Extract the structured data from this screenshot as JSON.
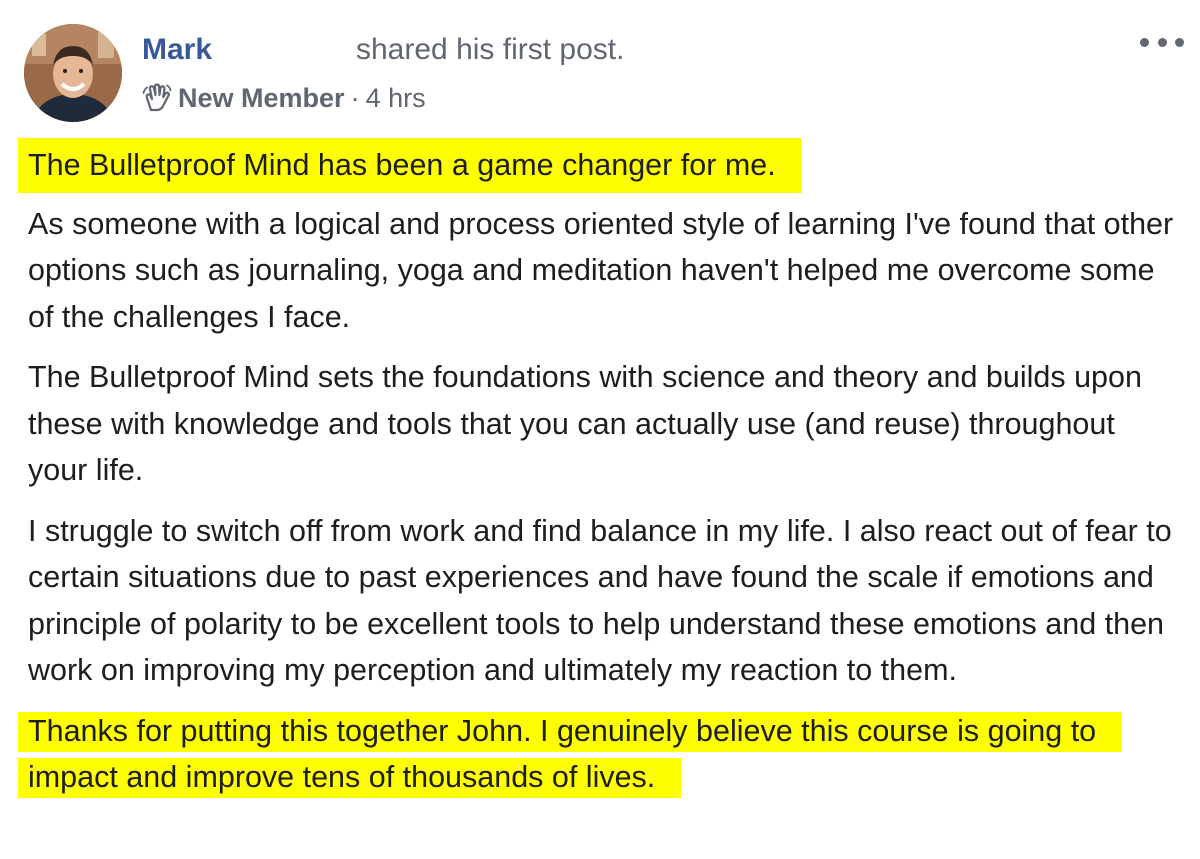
{
  "post": {
    "author": "Mark",
    "action": "shared his first post.",
    "badge": "New Member",
    "separator": "·",
    "time": "4 hrs",
    "icons": {
      "more": "more-horizontal-icon",
      "badge": "waving-hand-icon",
      "avatar": "profile-photo"
    },
    "highlight_color": "#ffff00",
    "name_color": "#385898",
    "paragraphs": [
      "The Bulletproof Mind has been a game changer for me.",
      "As someone with a logical and process oriented style of learning I've found that other options such as journaling, yoga and meditation haven't helped me overcome some of the challenges I face.",
      "The Bulletproof Mind sets the foundations with science and theory and builds upon these with knowledge and tools that you can actually use (and reuse) throughout your life.",
      "I struggle to switch off from work and find balance in my life. I also react out of fear to certain situations due to past experiences and have found the scale if emotions and principle of polarity to be excellent tools to help understand these emotions and then work on improving my perception and ultimately my reaction to them.",
      "Thanks for putting this together John. I genuinely believe this course is going to impact and improve tens of thousands of lives."
    ]
  }
}
